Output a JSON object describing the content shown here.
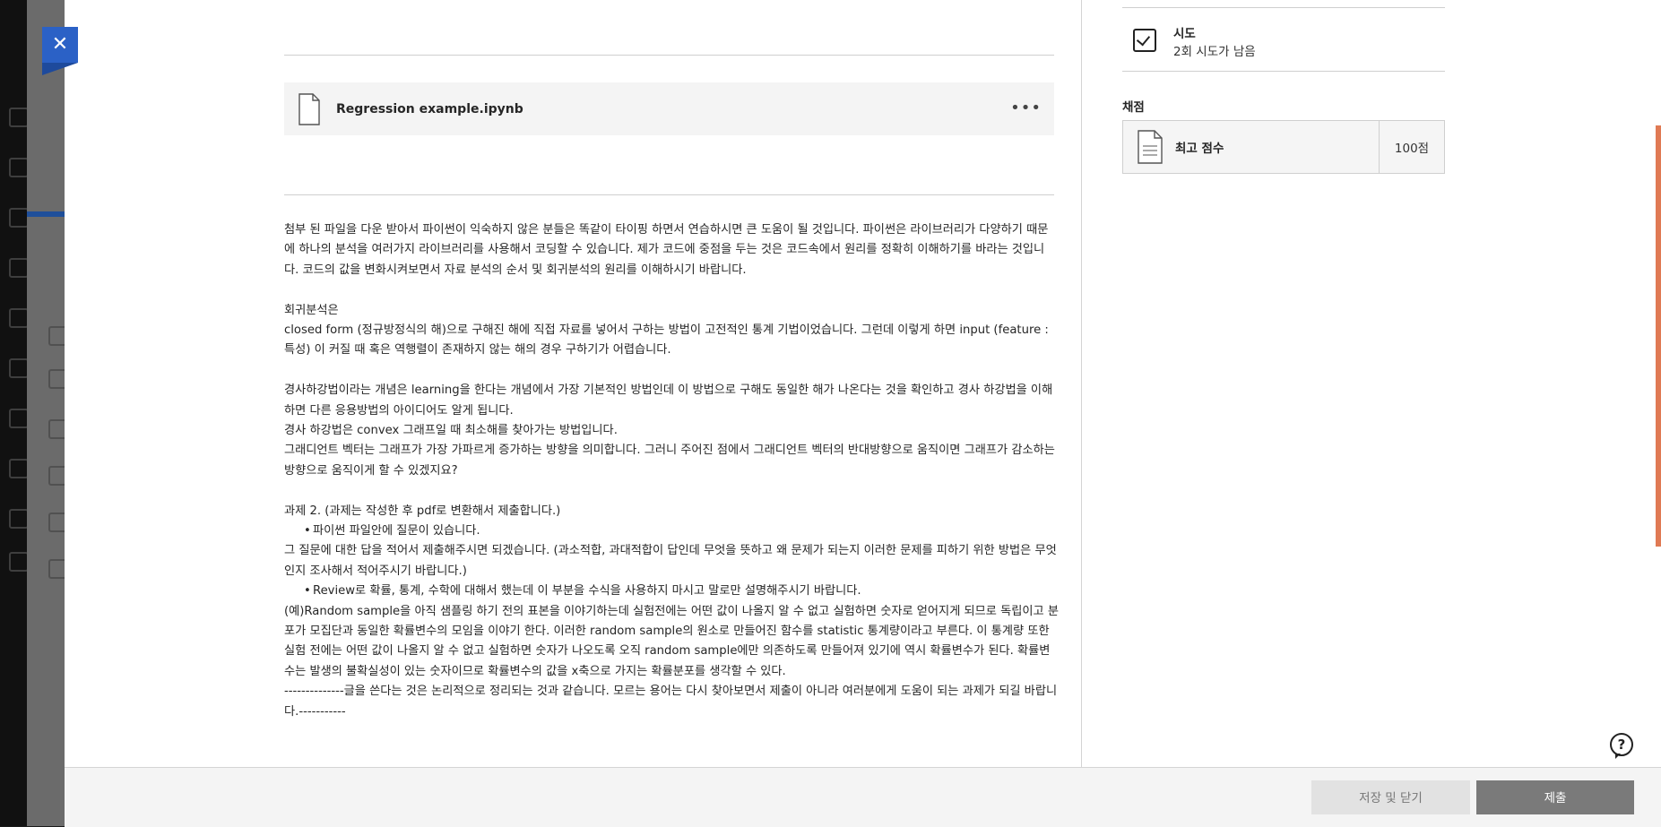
{
  "close": {
    "label": "✕"
  },
  "file": {
    "name": "Regression example.ipynb",
    "menu_icon": "more-horizontal-icon",
    "menu_label": "•••"
  },
  "description": [
    {
      "type": "p",
      "text": "첨부 된 파일을 다운 받아서 파이썬이 익숙하지 않은 분들은 똑같이 타이핑 하면서 연습하시면 큰 도움이 될 것입니다. 파이썬은 라이브러리가 다양하기 때문에 하나의 분석을 여러가지 라이브러리를 사용해서 코딩할 수 있습니다. 제가 코드에 중점을 두는 것은 코드속에서 원리를 정확히 이해하기를 바라는 것입니다. 코드의 값을 변화시켜보면서 자료 분석의 순서 및 회귀분석의 원리를 이해하시기 바랍니다."
    },
    {
      "type": "gap",
      "text": ""
    },
    {
      "type": "p",
      "text": "회귀분석은"
    },
    {
      "type": "p",
      "text": "closed form (정규방정식의 해)으로 구해진 해에 직접 자료를 넣어서 구하는 방법이 고전적인 통계 기법이었습니다. 그런데 이렇게 하면 input (feature :특성) 이 커질 때 혹은 역행렬이 존재하지 않는 해의 경우 구하기가 어렵습니다."
    },
    {
      "type": "gap",
      "text": ""
    },
    {
      "type": "p",
      "text": "경사하강법이라는 개념은 learning을 한다는 개념에서 가장 기본적인 방법인데 이 방법으로 구해도 동일한 해가 나온다는 것을 확인하고 경사 하강법을 이해하면 다른 응용방법의 아이디어도 알게 됩니다."
    },
    {
      "type": "p",
      "text": "경사 하강법은 convex 그래프일 때 최소해를 찾아가는 방법입니다."
    },
    {
      "type": "p",
      "text": "그래디언트 벡터는 그래프가 가장 가파르게 증가하는 방향을 의미합니다. 그러니 주어진 점에서 그래디언트 벡터의 반대방향으로 움직이면 그래프가 감소하는 방향으로 움직이게 할 수 있겠지요?"
    },
    {
      "type": "gap",
      "text": ""
    },
    {
      "type": "p",
      "text": "과제 2. (과제는 작성한 후 pdf로 변환해서 제출합니다.)"
    },
    {
      "type": "bul",
      "text": "파이썬 파일안에 질문이 있습니다."
    },
    {
      "type": "p",
      "text": "그 질문에 대한 답을 적어서 제출해주시면 되겠습니다. (과소적합, 과대적합이 답인데 무엇을 뜻하고 왜 문제가 되는지 이러한 문제를 피하기 위한 방법은 무엇인지 조사해서 적어주시기 바랍니다.)"
    },
    {
      "type": "bul",
      "text": "Review로 확률, 통계, 수학에 대해서 했는데 이 부분을 수식을 사용하지 마시고 말로만 설명해주시기 바랍니다."
    },
    {
      "type": "p",
      "text": "(예)Random sample을 아직 샘플링 하기 전의 표본을 이야기하는데 실험전에는 어떤 값이 나올지 알 수 없고 실험하면 숫자로 얻어지게 되므로 독립이고 분포가 모집단과 동일한 확률변수의 모임을 이야기 한다. 이러한 random sample의 원소로 만들어진 함수를 statistic 통계량이라고 부른다. 이 통계량 또한 실험 전에는 어떤 값이 나올지 알 수 없고 실험하면 숫자가 나오도록 오직 random sample에만 의존하도록 만들어져 있기에 역시 확률변수가 된다. 확률변수는 발생의 불확실성이 있는 숫자이므로 확률변수의 값을 x축으로 가지는 확률분포를 생각할 수 있다."
    },
    {
      "type": "p",
      "text": "--------------글을 쓴다는 것은 논리적으로 정리되는 것과 같습니다. 모르는 용어는 다시 찾아보면서 제출이 아니라 여러분에게 도움이 되는 과제가 되길 바랍니다.-----------"
    }
  ],
  "sidebar": {
    "attempts": {
      "title": "시도",
      "remaining": "2회 시도가 남음",
      "icon": "checkbox-icon"
    },
    "grading": {
      "label": "채점",
      "item_label": "최고 점수",
      "score": "100점",
      "icon": "document-icon"
    }
  },
  "help": {
    "icon": "help-icon",
    "label": "?"
  },
  "footer": {
    "save_label": "저장 및 닫기",
    "submit_label": "제출"
  },
  "colors": {
    "accent": "#2b61c6",
    "submit_bg": "#7a7a7a",
    "save_bg": "#e2e2e2"
  }
}
